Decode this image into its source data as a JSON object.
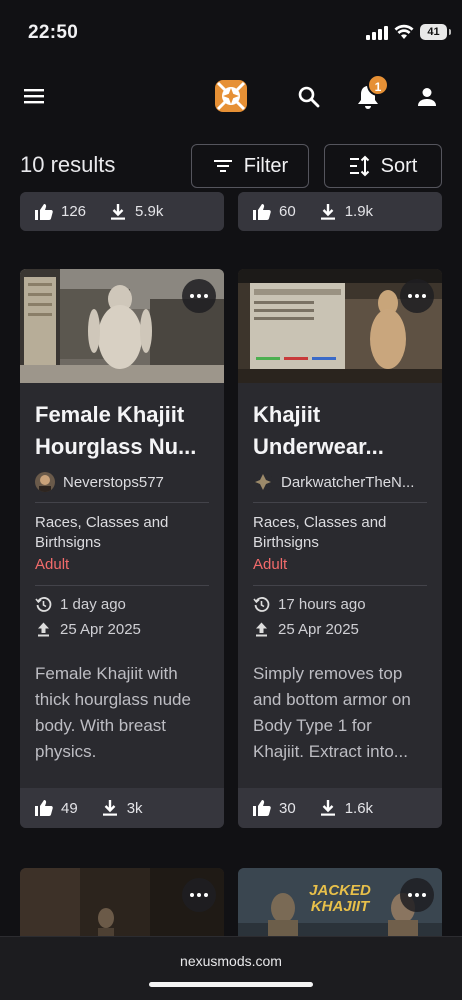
{
  "status_bar": {
    "time": "22:50",
    "battery": "41"
  },
  "header": {
    "notification_count": "1",
    "brand_color": "#e69035"
  },
  "toolbar": {
    "results": "10 results",
    "filter_label": "Filter",
    "sort_label": "Sort"
  },
  "top_partial_cards": [
    {
      "endorsements": "126",
      "downloads": "5.9k"
    },
    {
      "endorsements": "60",
      "downloads": "1.9k"
    }
  ],
  "cards": [
    {
      "title_line1": "Female Khajiit",
      "title_line2": "Hourglass Nu...",
      "author": "Neverstops577",
      "category_line1": "Races, Classes and",
      "category_line2": "Birthsigns",
      "tag": "Adult",
      "updated": "1 day ago",
      "uploaded": "25 Apr 2025",
      "description": [
        "Female Khajiit with",
        "thick hourglass nude",
        "body. With breast",
        "physics."
      ],
      "endorsements": "49",
      "downloads": "3k"
    },
    {
      "title_line1": "Khajiit",
      "title_line2": "Underwear...",
      "author": "DarkwatcherTheN...",
      "category_line1": "Races, Classes and",
      "category_line2": "Birthsigns",
      "tag": "Adult",
      "updated": "17 hours ago",
      "uploaded": "25 Apr 2025",
      "description": [
        "Simply removes top",
        "and bottom armor on",
        "Body Type 1 for",
        "Khajiit. Extract into..."
      ],
      "endorsements": "30",
      "downloads": "1.6k"
    }
  ],
  "bottom_partial_cards": [
    {
      "thumb_text": ""
    },
    {
      "thumb_text_line1": "JACKED",
      "thumb_text_line2": "KHAJIIT"
    }
  ],
  "browser": {
    "url": "nexusmods.com"
  },
  "icons": {
    "menu": "menu-icon",
    "logo": "nexus-logo-icon",
    "search": "search-icon",
    "bell": "bell-icon",
    "user": "user-icon",
    "filter": "filter-icon",
    "sort": "sort-icon",
    "thumbs_up": "thumbs-up-icon",
    "download": "download-icon",
    "more": "more-icon",
    "updated": "history-icon",
    "uploaded": "upload-icon"
  }
}
